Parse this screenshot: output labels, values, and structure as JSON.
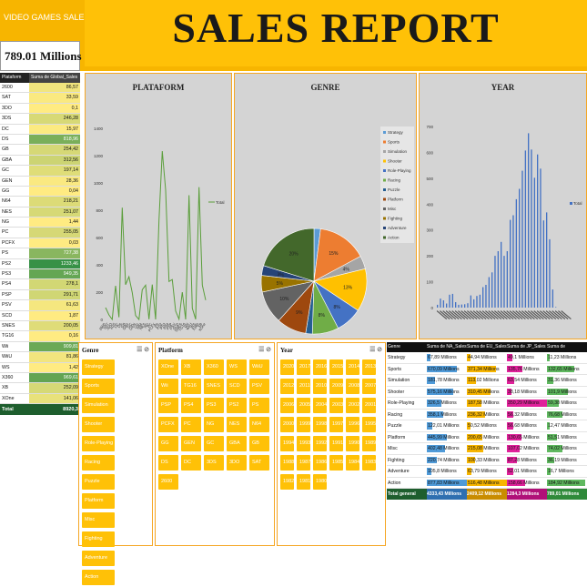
{
  "header": {
    "brand": "VIDEO GAMES SALES",
    "total": "789.01 Millions",
    "title": "SALES REPORT"
  },
  "platform_table": {
    "col1": "Plataform",
    "col2": "Suma de Global_Sales",
    "rows": [
      {
        "name": "2600",
        "value": "86,57"
      },
      {
        "name": "SAT",
        "value": "33,59"
      },
      {
        "name": "3DO",
        "value": "0,1"
      },
      {
        "name": "3DS",
        "value": "246,28"
      },
      {
        "name": "DC",
        "value": "15,97"
      },
      {
        "name": "DS",
        "value": "818,96"
      },
      {
        "name": "GB",
        "value": "254,42"
      },
      {
        "name": "GBA",
        "value": "312,56"
      },
      {
        "name": "GC",
        "value": "197,14"
      },
      {
        "name": "GEN",
        "value": "28,36"
      },
      {
        "name": "GG",
        "value": "0,04"
      },
      {
        "name": "N64",
        "value": "218,21"
      },
      {
        "name": "NES",
        "value": "251,07"
      },
      {
        "name": "NG",
        "value": "1,44"
      },
      {
        "name": "PC",
        "value": "255,05"
      },
      {
        "name": "PCFX",
        "value": "0,03"
      },
      {
        "name": "PS",
        "value": "727,38"
      },
      {
        "name": "PS2",
        "value": "1233,46"
      },
      {
        "name": "PS3",
        "value": "949,35"
      },
      {
        "name": "PS4",
        "value": "278,1"
      },
      {
        "name": "PSP",
        "value": "291,71"
      },
      {
        "name": "PSV",
        "value": "61,63"
      },
      {
        "name": "SCD",
        "value": "1,87"
      },
      {
        "name": "SNES",
        "value": "200,05"
      },
      {
        "name": "TG16",
        "value": "0,16"
      },
      {
        "name": "Wii",
        "value": "909,81"
      },
      {
        "name": "WiiU",
        "value": "81,86"
      },
      {
        "name": "WS",
        "value": "1,42"
      },
      {
        "name": "X360",
        "value": "969,61"
      },
      {
        "name": "XB",
        "value": "252,09"
      },
      {
        "name": "XOne",
        "value": "141,06"
      }
    ],
    "total_label": "Total general",
    "total_value": "8920,3"
  },
  "panels": {
    "platform_title": "PLATAFORM",
    "genre_title": "GENRE",
    "year_title": "YEAR"
  },
  "chart_data": [
    {
      "type": "line",
      "title": "PLATAFORM",
      "series": [
        {
          "name": "Total",
          "values": [
            86.57,
            33.59,
            0.1,
            246.28,
            15.97,
            818.96,
            254.42,
            312.56,
            197.14,
            28.36,
            0.04,
            218.21,
            251.07,
            1.44,
            255.05,
            0.03,
            727.38,
            1233.46,
            949.35,
            278.1,
            291.71,
            61.63,
            1.87,
            200.05,
            0.16,
            909.81,
            81.86,
            1.42,
            969.61,
            252.09,
            141.06
          ]
        }
      ],
      "categories": [
        "2600",
        "SAT",
        "3DO",
        "3DS",
        "DC",
        "DS",
        "GB",
        "GBA",
        "GC",
        "GEN",
        "GG",
        "N64",
        "NES",
        "NG",
        "PC",
        "PCFX",
        "PS",
        "PS2",
        "PS3",
        "PS4",
        "PSP",
        "PSV",
        "SCD",
        "SNES",
        "TG16",
        "Wii",
        "WiiU",
        "WS",
        "X360",
        "XB",
        "XOne"
      ],
      "y_ticks": [
        0,
        200,
        400,
        600,
        800,
        1000,
        1200,
        1400
      ],
      "ylim": [
        0,
        1400
      ]
    },
    {
      "type": "pie",
      "title": "GENRE",
      "slices": [
        {
          "label": "Strategy",
          "value": 2,
          "color": "#5b9bd5",
          "pct": ""
        },
        {
          "label": "Sports",
          "value": 15,
          "color": "#ed7d31",
          "pct": "15%"
        },
        {
          "label": "Simulation",
          "value": 4,
          "color": "#a5a5a5",
          "pct": "4%"
        },
        {
          "label": "Shooter",
          "value": 13,
          "color": "#ffc000",
          "pct": "13%"
        },
        {
          "label": "Role-Playing",
          "value": 8,
          "color": "#4472c4",
          "pct": "8%"
        },
        {
          "label": "Racing",
          "value": 8,
          "color": "#70ad47",
          "pct": "8%"
        },
        {
          "label": "Puzzle",
          "value": 2,
          "color": "#255e91",
          "pct": ""
        },
        {
          "label": "Platform",
          "value": 9,
          "color": "#9e480e",
          "pct": "9%"
        },
        {
          "label": "Misc",
          "value": 10,
          "color": "#636363",
          "pct": "10%"
        },
        {
          "label": "Fighting",
          "value": 5,
          "color": "#997300",
          "pct": "5%"
        },
        {
          "label": "Adventure",
          "value": 3,
          "color": "#264478",
          "pct": "3%"
        },
        {
          "label": "Action",
          "value": 20,
          "color": "#43682b",
          "pct": "20%"
        }
      ]
    },
    {
      "type": "bar",
      "title": "YEAR",
      "series": [
        {
          "name": "Total",
          "values": [
            11,
            35,
            28,
            16,
            50,
            53,
            21,
            11,
            12,
            13,
            17,
            47,
            32,
            45,
            50,
            79,
            88,
            118,
            136,
            200,
            218,
            254,
            200,
            218,
            339,
            357,
            419,
            459,
            529,
            607,
            674,
            611,
            502,
            592,
            537,
            337,
            368,
            264,
            70,
            2,
            0,
            0
          ]
        }
      ],
      "y_ticks": [
        0,
        100,
        200,
        300,
        400,
        500,
        600,
        700
      ],
      "ylim": [
        0,
        700
      ]
    }
  ],
  "slicers": {
    "genre": {
      "title": "Genre",
      "items": [
        "Strategy",
        "Sports",
        "Simulation",
        "Shooter",
        "Role-Playing",
        "Racing",
        "Puzzle",
        "Platform",
        "Misc",
        "Fighting",
        "Adventure",
        "Action"
      ]
    },
    "platform": {
      "title": "Platform",
      "items": [
        "XOne",
        "XB",
        "X360",
        "WS",
        "WiiU",
        "Wii",
        "TG16",
        "SNES",
        "SCD",
        "PSV",
        "PSP",
        "PS4",
        "PS3",
        "PS2",
        "PS",
        "PCFX",
        "PC",
        "NG",
        "NES",
        "N64",
        "GG",
        "GEN",
        "GC",
        "GBA",
        "GB",
        "DS",
        "DC",
        "3DS",
        "3DO",
        "SAT",
        "2600"
      ]
    },
    "year": {
      "title": "Year",
      "items": [
        "2020",
        "2017",
        "2016",
        "2015",
        "2014",
        "2013",
        "2012",
        "2011",
        "2010",
        "2009",
        "2008",
        "2007",
        "2006",
        "2005",
        "2004",
        "2003",
        "2002",
        "2001",
        "2000",
        "1999",
        "1998",
        "1997",
        "1996",
        "1995",
        "1994",
        "1993",
        "1992",
        "1991",
        "1990",
        "1989",
        "1988",
        "1987",
        "1986",
        "1985",
        "1984",
        "1983",
        "1982",
        "1981",
        "1980"
      ]
    }
  },
  "sales_table": {
    "headers": [
      "Genre",
      "Suma de NA_Sales",
      "Suma de EU_Sales",
      "Suma de JP_Sales",
      "Suma de Other_Sales"
    ],
    "rows": [
      {
        "genre": "Strategy",
        "na": "67,89 Millions",
        "eu": "44,94 Millions",
        "jp": "49,1 Millions",
        "other": "11,23 Millions",
        "fna": 0.08,
        "feu": 0.08,
        "fjp": 0.14,
        "fot": 0.06
      },
      {
        "genre": "Sports",
        "na": "670,09 Millions",
        "eu": "371,34 Millions",
        "jp": "135,76 Millions",
        "other": "132,65 Millions",
        "fna": 0.76,
        "feu": 0.72,
        "fjp": 0.38,
        "fot": 0.68
      },
      {
        "genre": "Simulation",
        "na": "181,78 Millions",
        "eu": "113,02 Millions",
        "jp": "63,54 Millions",
        "other": "31,36 Millions",
        "fna": 0.21,
        "feu": 0.22,
        "fjp": 0.18,
        "fot": 0.16
      },
      {
        "genre": "Shooter",
        "na": "575,16 Millions",
        "eu": "310,45 Millions",
        "jp": "38,18 Millions",
        "other": "101,9 Millions",
        "fna": 0.65,
        "feu": 0.6,
        "fjp": 0.11,
        "fot": 0.52
      },
      {
        "genre": "Role-Playing",
        "na": "326,5 Millions",
        "eu": "187,58 Millions",
        "jp": "350,29 Millions",
        "other": "59,38 Millions",
        "fna": 0.37,
        "feu": 0.36,
        "fjp": 1.0,
        "fot": 0.3
      },
      {
        "genre": "Racing",
        "na": "358,1 Millions",
        "eu": "236,32 Millions",
        "jp": "56,32 Millions",
        "other": "76,68 Millions",
        "fna": 0.41,
        "feu": 0.46,
        "fjp": 0.16,
        "fot": 0.39
      },
      {
        "genre": "Puzzle",
        "na": "122,01 Millions",
        "eu": "50,52 Millions",
        "jp": "56,68 Millions",
        "other": "12,47 Millions",
        "fna": 0.14,
        "feu": 0.1,
        "fjp": 0.16,
        "fot": 0.06
      },
      {
        "genre": "Platform",
        "na": "445,99 Millions",
        "eu": "200,65 Millions",
        "jp": "130,65 Millions",
        "other": "51,51 Millions",
        "fna": 0.51,
        "feu": 0.39,
        "fjp": 0.37,
        "fot": 0.26
      },
      {
        "genre": "Misc",
        "na": "402,48 Millions",
        "eu": "215,08 Millions",
        "jp": "107,02 Millions",
        "other": "74,02 Millions",
        "fna": 0.46,
        "feu": 0.42,
        "fjp": 0.31,
        "fot": 0.38
      },
      {
        "genre": "Fighting",
        "na": "220,74 Millions",
        "eu": "100,33 Millions",
        "jp": "87,28 Millions",
        "other": "36,19 Millions",
        "fna": 0.25,
        "feu": 0.2,
        "fjp": 0.25,
        "fot": 0.18
      },
      {
        "genre": "Adventure",
        "na": "105,8 Millions",
        "eu": "63,79 Millions",
        "jp": "52,01 Millions",
        "other": "16,7 Millions",
        "fna": 0.12,
        "feu": 0.12,
        "fjp": 0.15,
        "fot": 0.08
      },
      {
        "genre": "Action",
        "na": "877,83 Millions",
        "eu": "516,48 Millions",
        "jp": "158,66 Millions",
        "other": "184,92 Millions",
        "fna": 1.0,
        "feu": 1.0,
        "fjp": 0.45,
        "fot": 0.95
      }
    ],
    "total": {
      "label": "Total general",
      "na": "4333,43 Millions",
      "eu": "2409,12 Millions",
      "jp": "1284,3 Millions",
      "other": "789,01 Millions"
    },
    "colors": {
      "na": "#4f9ad8",
      "eu": "#f7b500",
      "jp": "#e0219a",
      "other": "#5fb85f"
    }
  }
}
